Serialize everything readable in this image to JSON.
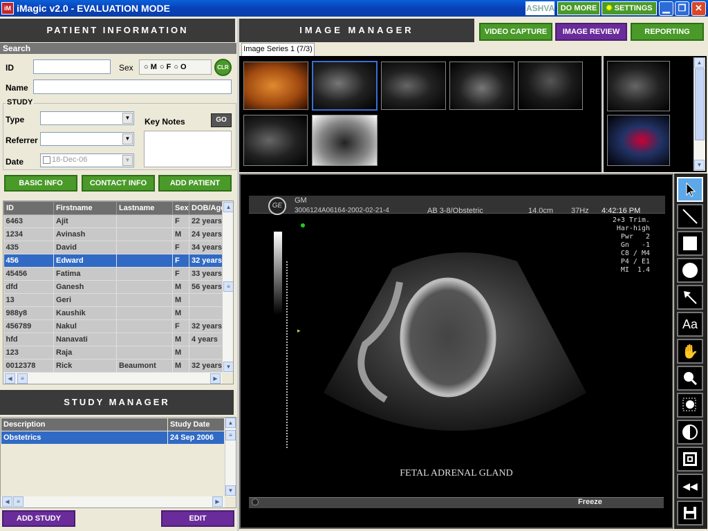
{
  "window": {
    "title": "iMagic v2.0 - EVALUATION MODE",
    "icon_text": "iM",
    "ashva": "ASHVA",
    "do_more": "DO MORE",
    "settings": "SETTINGS"
  },
  "patient_info": {
    "header": "PATIENT INFORMATION",
    "search": "Search",
    "id_label": "ID",
    "id_value": "",
    "sex_label": "Sex",
    "sex_options": [
      "M",
      "F",
      "O"
    ],
    "clr": "CLR",
    "name_label": "Name",
    "name_value": "",
    "study_label": "STUDY",
    "type_label": "Type",
    "type_value": "",
    "referrer_label": "Referrer",
    "referrer_value": "",
    "date_label": "Date",
    "date_value": "18-Dec-06",
    "key_notes_label": "Key Notes",
    "go": "GO",
    "key_notes_value": ""
  },
  "patient_buttons": {
    "basic": "BASIC INFO",
    "contact": "CONTACT INFO",
    "add": "ADD PATIENT"
  },
  "patients": {
    "headers": [
      "ID",
      "Firstname",
      "Lastname",
      "Sex",
      "DOB/Age"
    ],
    "rows": [
      [
        "6463",
        "Ajit",
        "",
        "F",
        "22 years"
      ],
      [
        "1234",
        "Avinash",
        "",
        "M",
        "24 years"
      ],
      [
        "435",
        "David",
        "",
        "F",
        "34 years"
      ],
      [
        "456",
        "Edward",
        "",
        "F",
        "32 years"
      ],
      [
        "45456",
        "Fatima",
        "",
        "F",
        "33 years"
      ],
      [
        "dfd",
        "Ganesh",
        "",
        "M",
        "56 years"
      ],
      [
        "13",
        "Geri",
        "",
        "M",
        ""
      ],
      [
        "988y8",
        "Kaushik",
        "",
        "M",
        ""
      ],
      [
        "456789",
        "Nakul",
        "",
        "F",
        "32 years"
      ],
      [
        "hfd",
        "Nanavati",
        "",
        "M",
        "4 years"
      ],
      [
        "123",
        "Raja",
        "",
        "M",
        ""
      ],
      [
        "0012378",
        "Rick",
        "Beaumont",
        "M",
        "32 years"
      ]
    ],
    "selected_index": 3
  },
  "study_manager": {
    "header": "STUDY MANAGER",
    "headers": [
      "Description",
      "Study Date"
    ],
    "rows": [
      [
        "Obstetrics",
        "24 Sep 2006"
      ]
    ],
    "add": "ADD STUDY",
    "edit": "EDIT"
  },
  "image_manager": {
    "header": "IMAGE MANAGER",
    "tabs": [
      "VIDEO CAPTURE",
      "IMAGE REVIEW",
      "REPORTING"
    ],
    "active_tab": 1,
    "series_tab": "Image Series 1 (7/3)"
  },
  "ultrasound": {
    "operator": "GM",
    "patient_line": "3006124A06164-2002-02-21-4",
    "probe": "AB 3-8/Obstetric",
    "depth": "14.0cm",
    "freq": "37Hz",
    "time": "4:42:16 PM",
    "params": [
      "2+3 Trim.",
      "Har-high",
      "Pwr   2",
      "Gn   -1",
      "C8 / M4",
      "P4 / E1",
      "MI  1.4"
    ],
    "caption": "FETAL ADRENAL GLAND",
    "freeze": "Freeze",
    "logo": "GE"
  },
  "tools": [
    "select-arrow-icon",
    "line-icon",
    "rectangle-icon",
    "ellipse-icon",
    "arrow-annotation-icon",
    "text-icon",
    "pan-hand-icon",
    "zoom-icon",
    "magnifier-region-icon",
    "contrast-icon",
    "fit-window-icon",
    "undo-icon",
    "save-icon"
  ],
  "tool_text": "Aa"
}
